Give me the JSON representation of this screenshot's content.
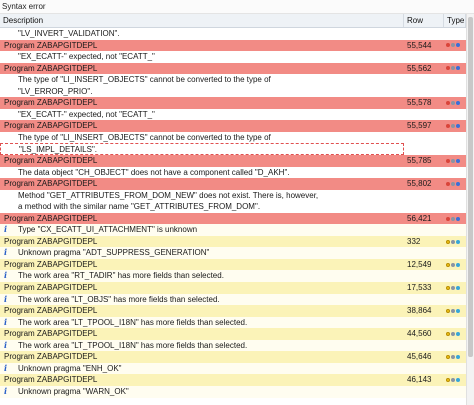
{
  "window": {
    "title": "Syntax error"
  },
  "columns": {
    "description": "Description",
    "row": "Row",
    "type": "Type"
  },
  "rows": [
    {
      "kind": "msg",
      "text": "\"LV_INVERT_VALIDATION\"."
    },
    {
      "kind": "error",
      "text": "Program ZABAPGITDEPL",
      "row": "55,544",
      "icon": "error-status-icon"
    },
    {
      "kind": "msg",
      "text": "\"EX_ECATT-\" expected, not \"ECATT_\""
    },
    {
      "kind": "error",
      "text": "Program ZABAPGITDEPL",
      "row": "55,562",
      "icon": "error-status-icon"
    },
    {
      "kind": "msg",
      "text": "The type of \"LI_INSERT_OBJECTS\" cannot be converted to the type of"
    },
    {
      "kind": "msg",
      "text": "\"LV_ERROR_PRIO\"."
    },
    {
      "kind": "error",
      "text": "Program ZABAPGITDEPL",
      "row": "55,578",
      "icon": "error-status-icon"
    },
    {
      "kind": "msg",
      "text": "\"EX_ECATT-\" expected, not \"ECATT_\""
    },
    {
      "kind": "error",
      "text": "Program ZABAPGITDEPL",
      "row": "55,597",
      "icon": "error-status-icon"
    },
    {
      "kind": "msg",
      "text": "The type of \"LI_INSERT_OBJECTS\" cannot be converted to the type of"
    },
    {
      "kind": "msg-sel",
      "text": "\"LS_IMPL_DETAILS\"."
    },
    {
      "kind": "error",
      "text": "Program ZABAPGITDEPL",
      "row": "55,785",
      "icon": "error-status-icon"
    },
    {
      "kind": "msg",
      "text": "The data object \"CH_OBJECT\" does not have a component called \"D_AKH\"."
    },
    {
      "kind": "error",
      "text": "Program ZABAPGITDEPL",
      "row": "55,802",
      "icon": "error-status-icon"
    },
    {
      "kind": "msg",
      "text": "Method \"GET_ATTRIBUTES_FROM_DOM_NEW\" does not exist. There is, however,"
    },
    {
      "kind": "msg",
      "text": "a method with the similar name \"GET_ATTRIBUTES_FROM_DOM\"."
    },
    {
      "kind": "error",
      "text": "Program ZABAPGITDEPL",
      "row": "56,421",
      "icon": "error-status-icon"
    },
    {
      "kind": "msg-help",
      "text": "Type \"CX_ECATT_UI_ATTACHMENT\" is unknown"
    },
    {
      "kind": "warn",
      "text": "Program ZABAPGITDEPL",
      "row": "332",
      "icon": "warning-status-icon"
    },
    {
      "kind": "msg-help",
      "text": "Unknown pragma \"ADT_SUPPRESS_GENERATION\""
    },
    {
      "kind": "warn",
      "text": "Program ZABAPGITDEPL",
      "row": "12,549",
      "icon": "warning-status-icon"
    },
    {
      "kind": "msg-help",
      "text": "The work area \"RT_TADIR\" has more fields than selected."
    },
    {
      "kind": "warn",
      "text": "Program ZABAPGITDEPL",
      "row": "17,533",
      "icon": "warning-status-icon"
    },
    {
      "kind": "msg-help",
      "text": "The work area \"LT_OBJS\" has more fields than selected."
    },
    {
      "kind": "warn",
      "text": "Program ZABAPGITDEPL",
      "row": "38,864",
      "icon": "warning-status-icon"
    },
    {
      "kind": "msg-help",
      "text": "The work area \"LT_TPOOL_I18N\" has more fields than selected."
    },
    {
      "kind": "warn",
      "text": "Program ZABAPGITDEPL",
      "row": "44,560",
      "icon": "warning-status-icon"
    },
    {
      "kind": "msg-help",
      "text": "The work area \"LT_TPOOL_I18N\" has more fields than selected."
    },
    {
      "kind": "warn",
      "text": "Program ZABAPGITDEPL",
      "row": "45,646",
      "icon": "warning-status-icon"
    },
    {
      "kind": "msg-help",
      "text": "Unknown pragma \"ENH_OK\""
    },
    {
      "kind": "warn",
      "text": "Program ZABAPGITDEPL",
      "row": "46,143",
      "icon": "warning-status-icon"
    },
    {
      "kind": "msg-help",
      "text": "Unknown pragma \"WARN_OK\""
    }
  ]
}
